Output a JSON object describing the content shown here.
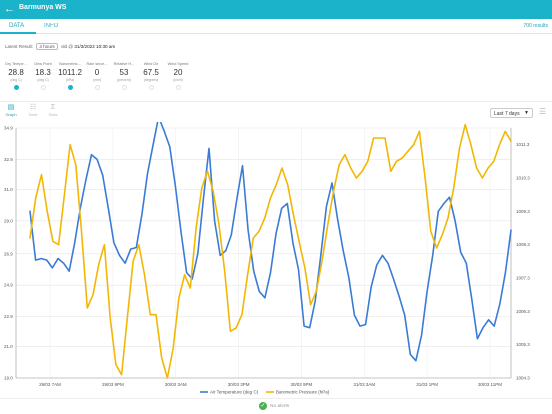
{
  "appbar": {
    "title": "Barmunya WS"
  },
  "tabs": [
    {
      "label": "DATA"
    },
    {
      "label": "INFO"
    }
  ],
  "units_label": "700 results",
  "latest": {
    "prefix": "Latest Result:",
    "pill": "3 hours",
    "ago": "old @",
    "date": "31/3/2022 10:30 am"
  },
  "sensors": [
    {
      "label": "Dry Tempe...",
      "value": "28.8",
      "unit": "(deg C)",
      "selected": true
    },
    {
      "label": "Dew Point",
      "value": "18.3",
      "unit": "(deg C)",
      "selected": false
    },
    {
      "label": "Barometric...",
      "value": "1011.2",
      "unit": "(hPa)",
      "selected": true
    },
    {
      "label": "Rain since...",
      "value": "0",
      "unit": "(mm)",
      "selected": false
    },
    {
      "label": "Relative H...",
      "value": "53",
      "unit": "(percent)",
      "selected": false
    },
    {
      "label": "Wind Dir",
      "value": "67.5",
      "unit": "(degrees)",
      "selected": false
    },
    {
      "label": "Wind Speed",
      "value": "20",
      "unit": "(km/h)",
      "selected": false
    }
  ],
  "tools": [
    {
      "label": "Graph",
      "icon": "chart-icon"
    },
    {
      "label": "Table",
      "icon": "table-icon"
    },
    {
      "label": "Stats",
      "icon": "sigma-icon"
    }
  ],
  "range_select": {
    "value": "Last 7 days"
  },
  "footer": {
    "status": "No alerts"
  },
  "chart_data": {
    "type": "line",
    "x_ticks": [
      "29/03 7AM",
      "29/03 9PM",
      "30/03 3AM",
      "30/03 3PM",
      "30/03 9PM",
      "31/03 3AM",
      "31/03 1PM",
      "30/03 11PM"
    ],
    "y_left": {
      "ticks": [
        "19.0",
        "21.0",
        "22.9",
        "24.9",
        "26.9",
        "29.0",
        "31.0",
        "32.9",
        "34.9"
      ],
      "range": [
        19.0,
        34.9
      ]
    },
    "y_right": {
      "ticks": [
        "1004.3",
        "1005.3",
        "1006.3",
        "1007.3",
        "1008.3",
        "1009.3",
        "1010.3",
        "1011.3"
      ],
      "range": [
        1004.3,
        1011.8
      ]
    },
    "series": [
      {
        "name": "Air Temperature (deg C)",
        "color": "#3a7bd5",
        "axis": "left",
        "values": [
          29.6,
          26.5,
          26.6,
          26.5,
          26.0,
          26.6,
          26.3,
          25.8,
          27.6,
          29.8,
          31.6,
          33.2,
          32.9,
          31.9,
          29.8,
          27.6,
          26.8,
          26.3,
          27.2,
          27.3,
          29.4,
          32.0,
          33.8,
          35.6,
          34.7,
          33.7,
          31.2,
          28.3,
          25.7,
          25.3,
          26.9,
          30.4,
          33.6,
          29.0,
          26.8,
          27.1,
          28.1,
          30.4,
          32.5,
          28.4,
          25.8,
          24.5,
          24.1,
          25.7,
          28.2,
          29.8,
          30.1,
          27.6,
          25.9,
          22.3,
          22.2,
          23.9,
          26.8,
          29.9,
          31.4,
          29.1,
          27.1,
          25.4,
          23.0,
          22.3,
          22.4,
          24.8,
          26.2,
          26.8,
          26.3,
          25.3,
          24.2,
          23.0,
          20.5,
          20.1,
          21.7,
          24.5,
          26.8,
          29.6,
          30.1,
          30.5,
          29.0,
          27.0,
          26.3,
          24.0,
          21.5,
          22.2,
          22.7,
          22.3,
          23.7,
          25.7,
          28.4
        ]
      },
      {
        "name": "Barometric Pressure (hPa)",
        "color": "#f2b705",
        "axis": "right",
        "values": [
          1008.5,
          1009.7,
          1010.4,
          1009.3,
          1008.4,
          1008.3,
          1009.8,
          1011.3,
          1010.7,
          1008.7,
          1006.4,
          1006.8,
          1007.7,
          1008.3,
          1006.1,
          1004.7,
          1004.4,
          1006.1,
          1007.8,
          1008.3,
          1007.4,
          1006.2,
          1006.2,
          1004.9,
          1004.3,
          1005.2,
          1006.7,
          1007.4,
          1007.0,
          1008.8,
          1010.0,
          1010.5,
          1009.9,
          1008.9,
          1007.5,
          1005.7,
          1005.8,
          1006.2,
          1007.4,
          1008.5,
          1008.7,
          1009.1,
          1009.7,
          1010.1,
          1010.6,
          1010.1,
          1009.2,
          1008.4,
          1007.6,
          1006.5,
          1006.9,
          1007.8,
          1008.9,
          1009.9,
          1010.7,
          1011.0,
          1010.6,
          1010.3,
          1010.5,
          1010.8,
          1011.5,
          1011.5,
          1011.5,
          1010.5,
          1010.8,
          1010.9,
          1011.1,
          1011.3,
          1011.7,
          1010.3,
          1008.7,
          1008.2,
          1008.6,
          1009.1,
          1010.0,
          1011.2,
          1011.9,
          1011.3,
          1010.6,
          1010.3,
          1010.6,
          1010.8,
          1011.3,
          1011.7,
          1011.4
        ]
      }
    ],
    "grid": true,
    "legend": "bottom"
  }
}
